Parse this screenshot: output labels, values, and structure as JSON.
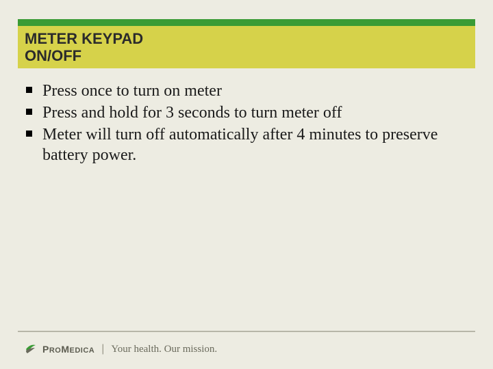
{
  "header": {
    "title": "METER KEYPAD\nON/OFF"
  },
  "bullets": [
    "Press once to turn on meter",
    "Press and hold for 3 seconds to turn meter off",
    "Meter will turn off automatically after 4 minutes to preserve battery power."
  ],
  "footer": {
    "brand_first": "P",
    "brand_rest": "RO",
    "brand_second_first": "M",
    "brand_second_rest": "EDICA",
    "tagline": "Your health. Our mission."
  },
  "colors": {
    "green": "#3a9b35",
    "yellow": "#d6d24a",
    "bg": "#edece2"
  }
}
